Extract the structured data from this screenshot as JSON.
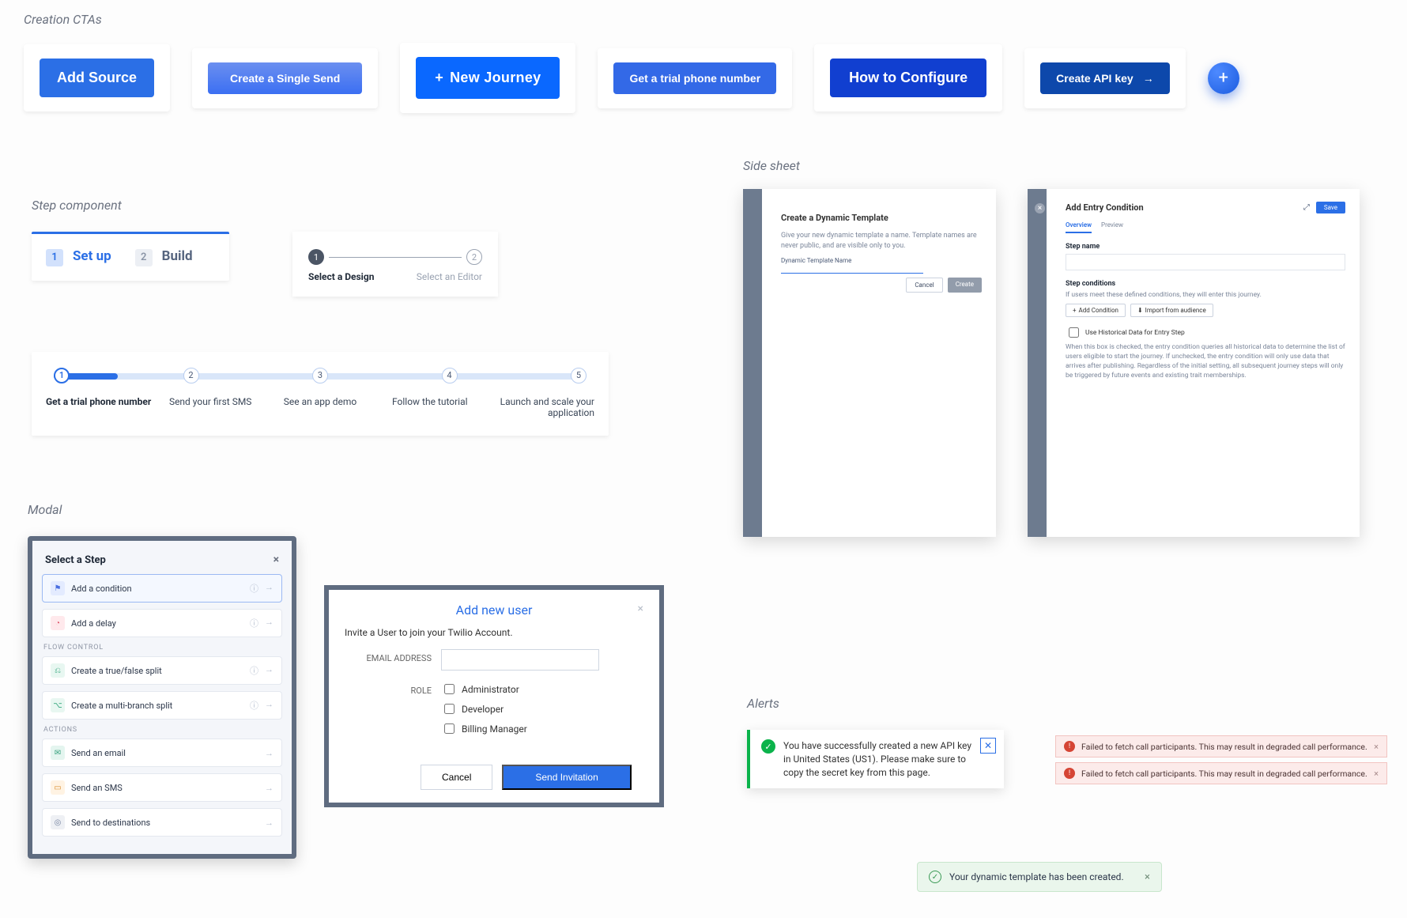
{
  "sections": {
    "ctas": "Creation CTAs",
    "step": "Step component",
    "side_sheet": "Side sheet",
    "modal": "Modal",
    "alerts": "Alerts"
  },
  "ctas": {
    "add_source": "Add Source",
    "single_send": "Create a Single Send",
    "new_journey": "New Journey",
    "trial_number": "Get a trial phone number",
    "how_to_configure": "How to Configure",
    "create_api_key": "Create API key"
  },
  "step1": {
    "num1": "1",
    "label1": "Set up",
    "num2": "2",
    "label2": "Build"
  },
  "step2": {
    "num1": "1",
    "label1": "Select a Design",
    "num2": "2",
    "label2": "Select an Editor"
  },
  "step_panel": {
    "nodes": [
      "1",
      "2",
      "3",
      "4",
      "5"
    ],
    "labels": [
      "Get a trial phone number",
      "Send your first SMS",
      "See an app demo",
      "Follow the tutorial",
      "Launch and scale your application"
    ]
  },
  "side1": {
    "title": "Create a Dynamic Template",
    "desc": "Give your new dynamic template a name. Template names are never public, and are visible only to you.",
    "label": "Dynamic Template Name",
    "cancel": "Cancel",
    "create": "Create"
  },
  "side2": {
    "title": "Add Entry Condition",
    "save": "Save",
    "tabs": {
      "overview": "Overview",
      "preview": "Preview"
    },
    "step_name_label": "Step name",
    "step_conditions_label": "Step conditions",
    "step_conditions_desc": "If users meet these defined conditions, they will enter this journey.",
    "add_condition": "Add Condition",
    "import_audience": "Import from audience",
    "historical_label": "Use Historical Data for Entry Step",
    "historical_desc": "When this box is checked, the entry condition queries all historical data to determine the list of users eligible to start the journey. If unchecked, the entry condition will only use data that arrives after publishing. Regardless of the initial setting, all subsequent journey steps will only be triggered by future events and existing trait memberships."
  },
  "modal1": {
    "title": "Select a Step",
    "items_top": [
      {
        "label": "Add a condition",
        "icon_name": "condition-icon",
        "selected": true
      },
      {
        "label": "Add a delay",
        "icon_name": "delay-icon",
        "selected": false
      }
    ],
    "group_flow": "FLOW CONTROL",
    "items_flow": [
      {
        "label": "Create a true/false split",
        "icon_name": "split-icon"
      },
      {
        "label": "Create a multi-branch split",
        "icon_name": "branch-icon"
      }
    ],
    "group_actions": "ACTIONS",
    "items_actions": [
      {
        "label": "Send an email",
        "icon_name": "email-icon"
      },
      {
        "label": "Send an SMS",
        "icon_name": "sms-icon"
      },
      {
        "label": "Send to destinations",
        "icon_name": "destination-icon"
      }
    ]
  },
  "modal2": {
    "title": "Add new user",
    "desc": "Invite a User to join your Twilio Account.",
    "email_label": "EMAIL ADDRESS",
    "role_label": "ROLE",
    "roles": [
      "Administrator",
      "Developer",
      "Billing Manager"
    ],
    "cancel": "Cancel",
    "send": "Send Invitation"
  },
  "alerts": {
    "success_msg": "You have successfully created a new API key in United States (US1). Please make sure to copy the secret key from this page.",
    "error_msg": "Failed to fetch call participants. This may result in degraded call performance.",
    "toast_msg": "Your dynamic template has been created."
  }
}
